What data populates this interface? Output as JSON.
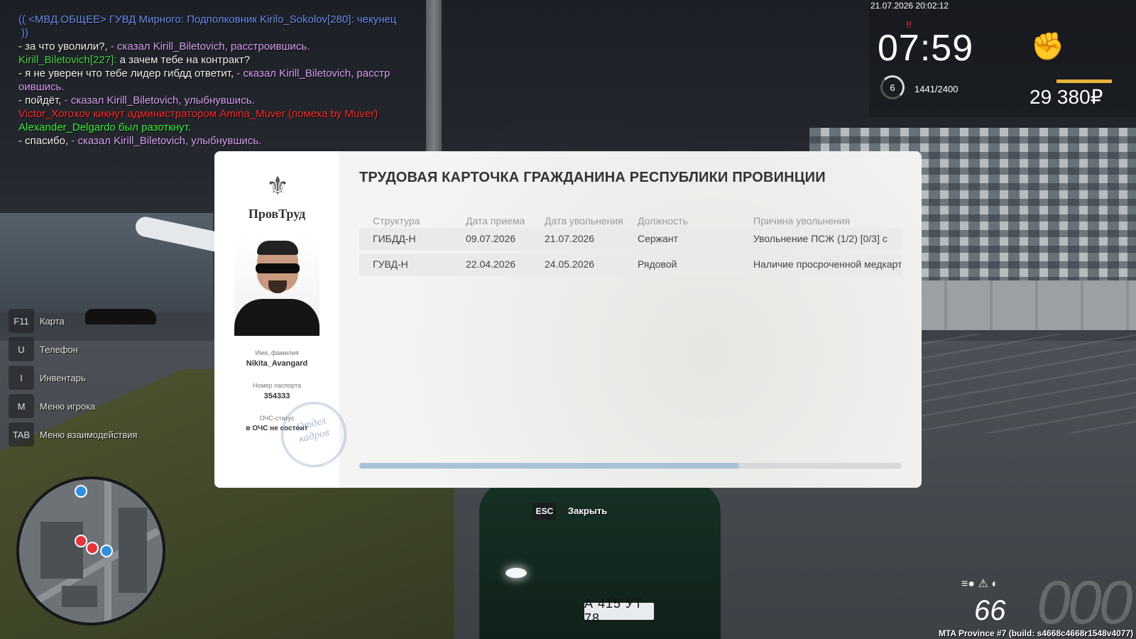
{
  "chat": [
    {
      "parts": [
        {
          "text": "(( <МВД.ОБЩЕЕ> ГУВД Мирного: Подполковник Kirilo_Sokolov[280]: чекунец",
          "color": "blue"
        }
      ]
    },
    {
      "parts": [
        {
          "text": " ))",
          "color": "blue"
        }
      ]
    },
    {
      "parts": [
        {
          "text": "- за что уволили?, ",
          "color": "white"
        },
        {
          "text": "- сказал Kirill_Biletovich, расстроившись.",
          "color": "pink"
        }
      ]
    },
    {
      "parts": [
        {
          "text": "Kirill_Biletovich[227]: ",
          "color": "green"
        },
        {
          "text": "а зачем тебе на контракт?",
          "color": "white"
        }
      ]
    },
    {
      "parts": [
        {
          "text": "- я не уверен что тебе лидер гибдд ответит, ",
          "color": "white"
        },
        {
          "text": "- сказал Kirill_Biletovich, расстр",
          "color": "pink"
        }
      ]
    },
    {
      "parts": [
        {
          "text": "оившись.",
          "color": "pink"
        }
      ]
    },
    {
      "parts": [
        {
          "text": "- пойдёт, ",
          "color": "white"
        },
        {
          "text": "- сказал Kirill_Biletovich, улыбнувшись.",
          "color": "pink"
        }
      ]
    },
    {
      "parts": [
        {
          "text": "Victor_Xoroxov кикнут администратором Amina_Muver (помеха by Muver)",
          "color": "red"
        }
      ]
    },
    {
      "parts": [
        {
          "text": "Alexander_Delgardo был разоткнут.",
          "color": "lime"
        }
      ]
    },
    {
      "parts": [
        {
          "text": "- спасибо, ",
          "color": "white"
        },
        {
          "text": "- сказал Kirill_Biletovich, улыбнувшись.",
          "color": "pink"
        }
      ]
    }
  ],
  "hud": {
    "datetime": "21.07.2026 20:02:12",
    "warn": "!!",
    "time": "07:59",
    "level": "6",
    "xp": "1441/2400",
    "money": "29 380₽"
  },
  "keys": [
    {
      "key": "F11",
      "label": "Карта"
    },
    {
      "key": "U",
      "label": "Телефон"
    },
    {
      "key": "I",
      "label": "Инвентарь"
    },
    {
      "key": "M",
      "label": "Меню игрока"
    },
    {
      "key": "TAB",
      "label": "Меню взаимодействия"
    }
  ],
  "speed": {
    "value": "66",
    "ghost": "000"
  },
  "build": "MTA Province #7 (build: s4668c4668r1548v4077)",
  "plate": "А 415 УТ 78",
  "card": {
    "brand": "ПровТруд",
    "name_label": "Имя, фамилия",
    "name": "Nikita_Avangard",
    "passport_label": "Номер паспорта",
    "passport": "354333",
    "och_label": "ОЧС-статус",
    "och": "в ОЧС не состоит",
    "stamp": "Отдел кадров",
    "title": "ТРУДОВАЯ КАРТОЧКА ГРАЖДАНИНА РЕСПУБЛИКИ ПРОВИНЦИИ",
    "columns": [
      "Структура",
      "Дата приема",
      "Дата увольнения",
      "Должность",
      "Причина увольнения"
    ],
    "rows": [
      [
        "ГИБДД-Н",
        "09.07.2026",
        "21.07.2026",
        "Сержант",
        "Увольнение ПСЖ (1/2) [0/3] с"
      ],
      [
        "ГУВД-Н",
        "22.04.2026",
        "24.05.2026",
        "Рядовой",
        "Наличие просроченной медкарт"
      ]
    ],
    "scroll_fraction": 0.7
  },
  "close": {
    "key": "ESC",
    "label": "Закрыть"
  },
  "colors": {
    "accent": "#a9c1d9",
    "money_bar": "#e8b33a"
  }
}
